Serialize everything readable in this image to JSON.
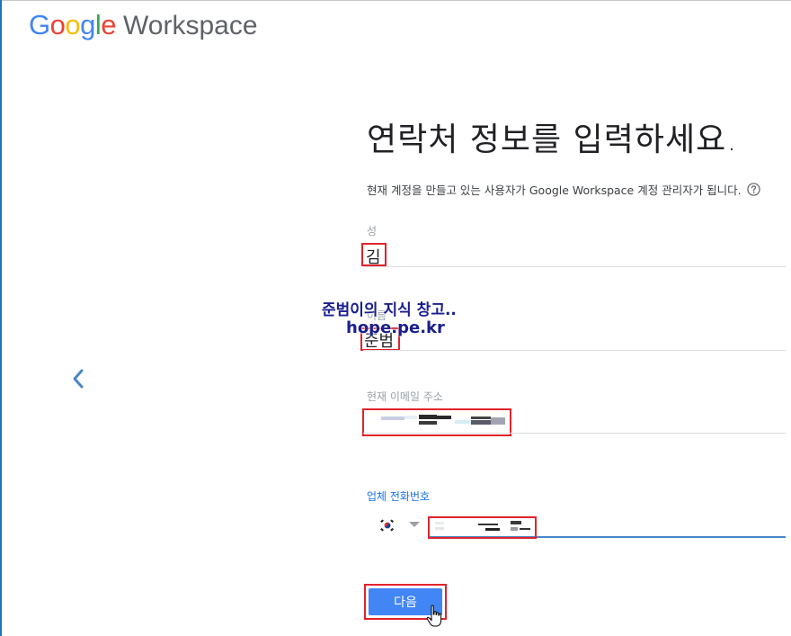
{
  "logo": {
    "letters": [
      {
        "char": "G",
        "color": "#4285F4"
      },
      {
        "char": "o",
        "color": "#EA4335"
      },
      {
        "char": "o",
        "color": "#FBBC05"
      },
      {
        "char": "g",
        "color": "#4285F4"
      },
      {
        "char": "l",
        "color": "#34A853"
      },
      {
        "char": "e",
        "color": "#EA4335"
      }
    ],
    "product": "Workspace"
  },
  "headline": "연락처 정보를 입력하세요.",
  "subtitle": "현재 계정을 만들고 있는 사용자가 Google Workspace 계정 관리자가 됩니다.",
  "form": {
    "last_name": {
      "label": "성",
      "value": "김"
    },
    "first_name": {
      "label": "이름",
      "value": "준범"
    },
    "email": {
      "label": "현재 이메일 주소"
    },
    "phone": {
      "label": "업체 전화번호"
    }
  },
  "next_button": {
    "label": "다음"
  },
  "watermark": {
    "line1": "준범이의 지식 창고..",
    "line2": "hope.pe.kr"
  },
  "colors": {
    "accent": "#4285F4",
    "highlight_box": "#E0242B",
    "focus_underline": "#4A86C5"
  },
  "icons": {
    "back": "chevron-left-icon",
    "help": "help-circle-icon",
    "flag": "south-korea-flag-icon",
    "caret": "caret-down-icon"
  }
}
